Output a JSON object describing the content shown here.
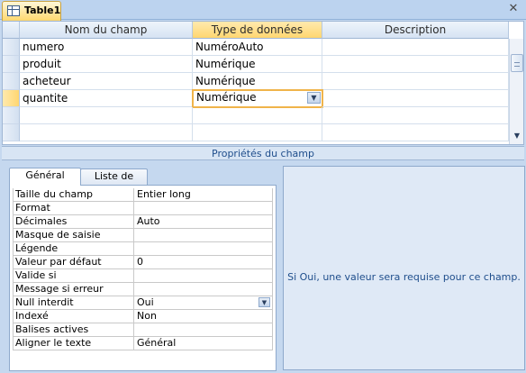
{
  "document_tab": {
    "title": "Table1",
    "icon": "table-icon"
  },
  "window": {
    "close_icon": "close-icon"
  },
  "grid": {
    "columns": [
      "Nom du champ",
      "Type de données",
      "Description"
    ],
    "rows": [
      {
        "name": "numero",
        "type": "NuméroAuto",
        "description": ""
      },
      {
        "name": "produit",
        "type": "Numérique",
        "description": ""
      },
      {
        "name": "acheteur",
        "type": "Numérique",
        "description": ""
      },
      {
        "name": "quantite",
        "type": "Numérique",
        "description": ""
      }
    ],
    "active_row_index": 3
  },
  "properties": {
    "section_title": "Propriétés du champ",
    "tabs": [
      "Général",
      "Liste de choix"
    ],
    "active_tab": "Général",
    "rows": [
      {
        "label": "Taille du champ",
        "value": "Entier long"
      },
      {
        "label": "Format",
        "value": ""
      },
      {
        "label": "Décimales",
        "value": "Auto"
      },
      {
        "label": "Masque de saisie",
        "value": ""
      },
      {
        "label": "Légende",
        "value": ""
      },
      {
        "label": "Valeur par défaut",
        "value": "0"
      },
      {
        "label": "Valide si",
        "value": ""
      },
      {
        "label": "Message si erreur",
        "value": ""
      },
      {
        "label": "Null interdit",
        "value": "Oui"
      },
      {
        "label": "Indexé",
        "value": "Non"
      },
      {
        "label": "Balises actives",
        "value": ""
      },
      {
        "label": "Aligner le texte",
        "value": "Général"
      }
    ],
    "help_text": "Si Oui, une valeur sera requise pour ce champ."
  }
}
